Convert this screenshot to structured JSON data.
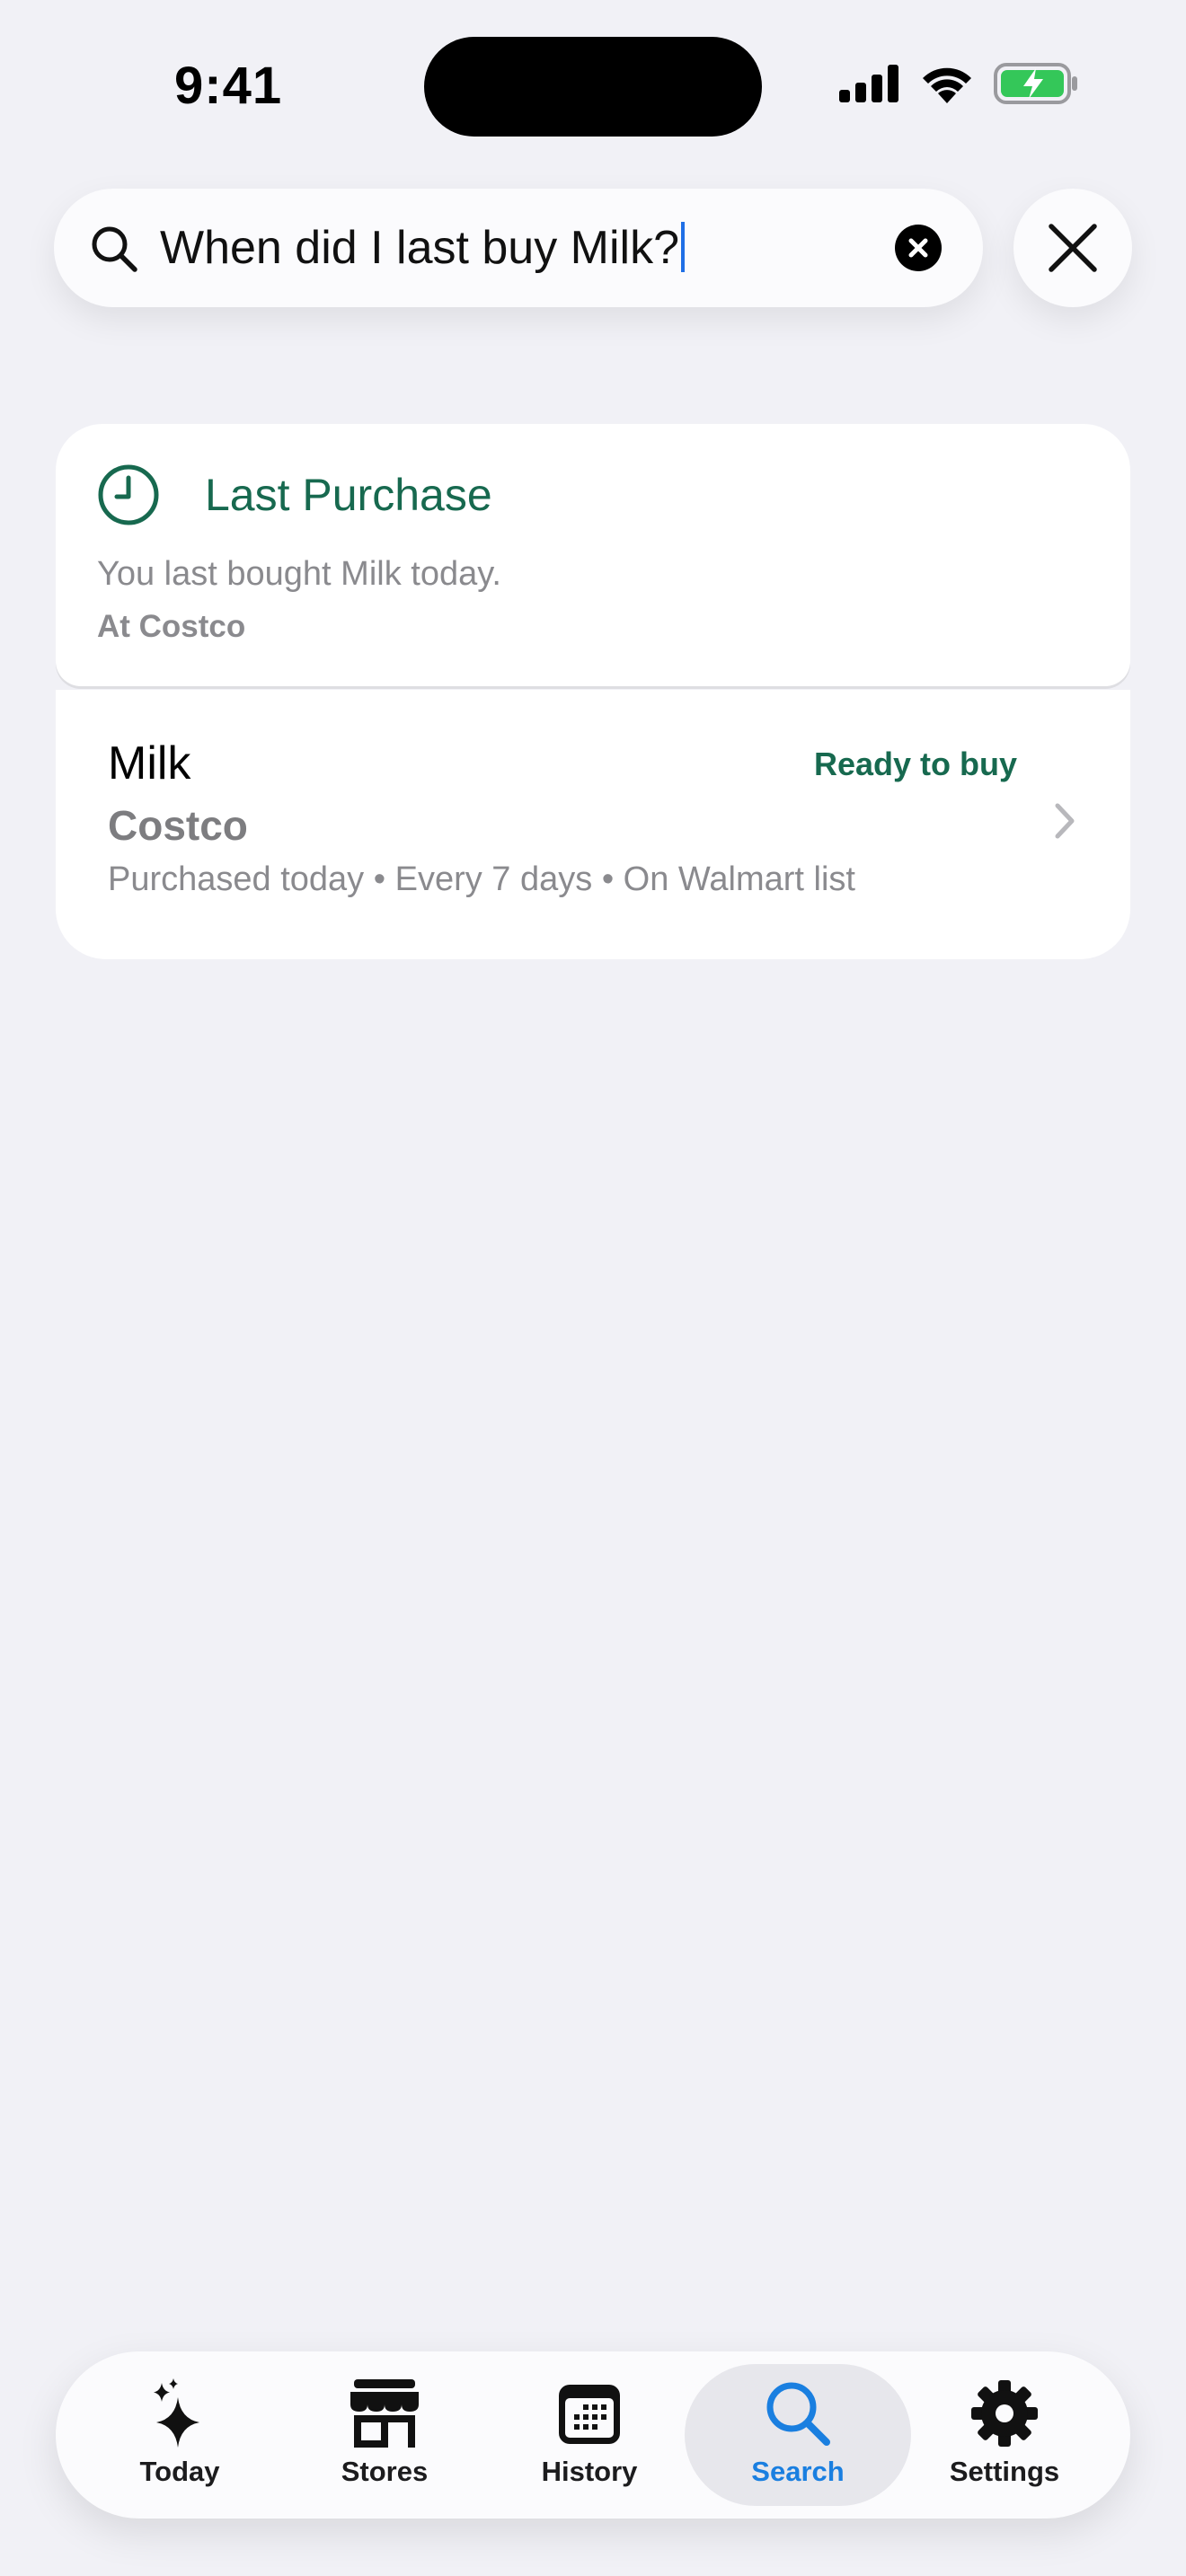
{
  "status_bar": {
    "time": "9:41"
  },
  "search": {
    "query": "When did I last buy Milk?"
  },
  "answer_card": {
    "title": "Last Purchase",
    "answer": "You last bought Milk today.",
    "store_line": "At Costco",
    "icon": "clock-icon"
  },
  "result_item": {
    "name": "Milk",
    "status": "Ready to buy",
    "store": "Costco",
    "meta": "Purchased today • Every 7 days • On Walmart list"
  },
  "tab_bar": {
    "active": "search",
    "tabs": [
      {
        "label": "Today",
        "icon": "sparkles-icon"
      },
      {
        "label": "Stores",
        "icon": "storefront-icon"
      },
      {
        "label": "History",
        "icon": "calendar-icon"
      },
      {
        "label": "Search",
        "icon": "search-icon"
      },
      {
        "label": "Settings",
        "icon": "gear-icon"
      }
    ]
  },
  "colors": {
    "accent_green": "#17694f",
    "accent_blue": "#1a7fe0",
    "background": "#f1f1f6",
    "battery_green": "#34c759"
  }
}
